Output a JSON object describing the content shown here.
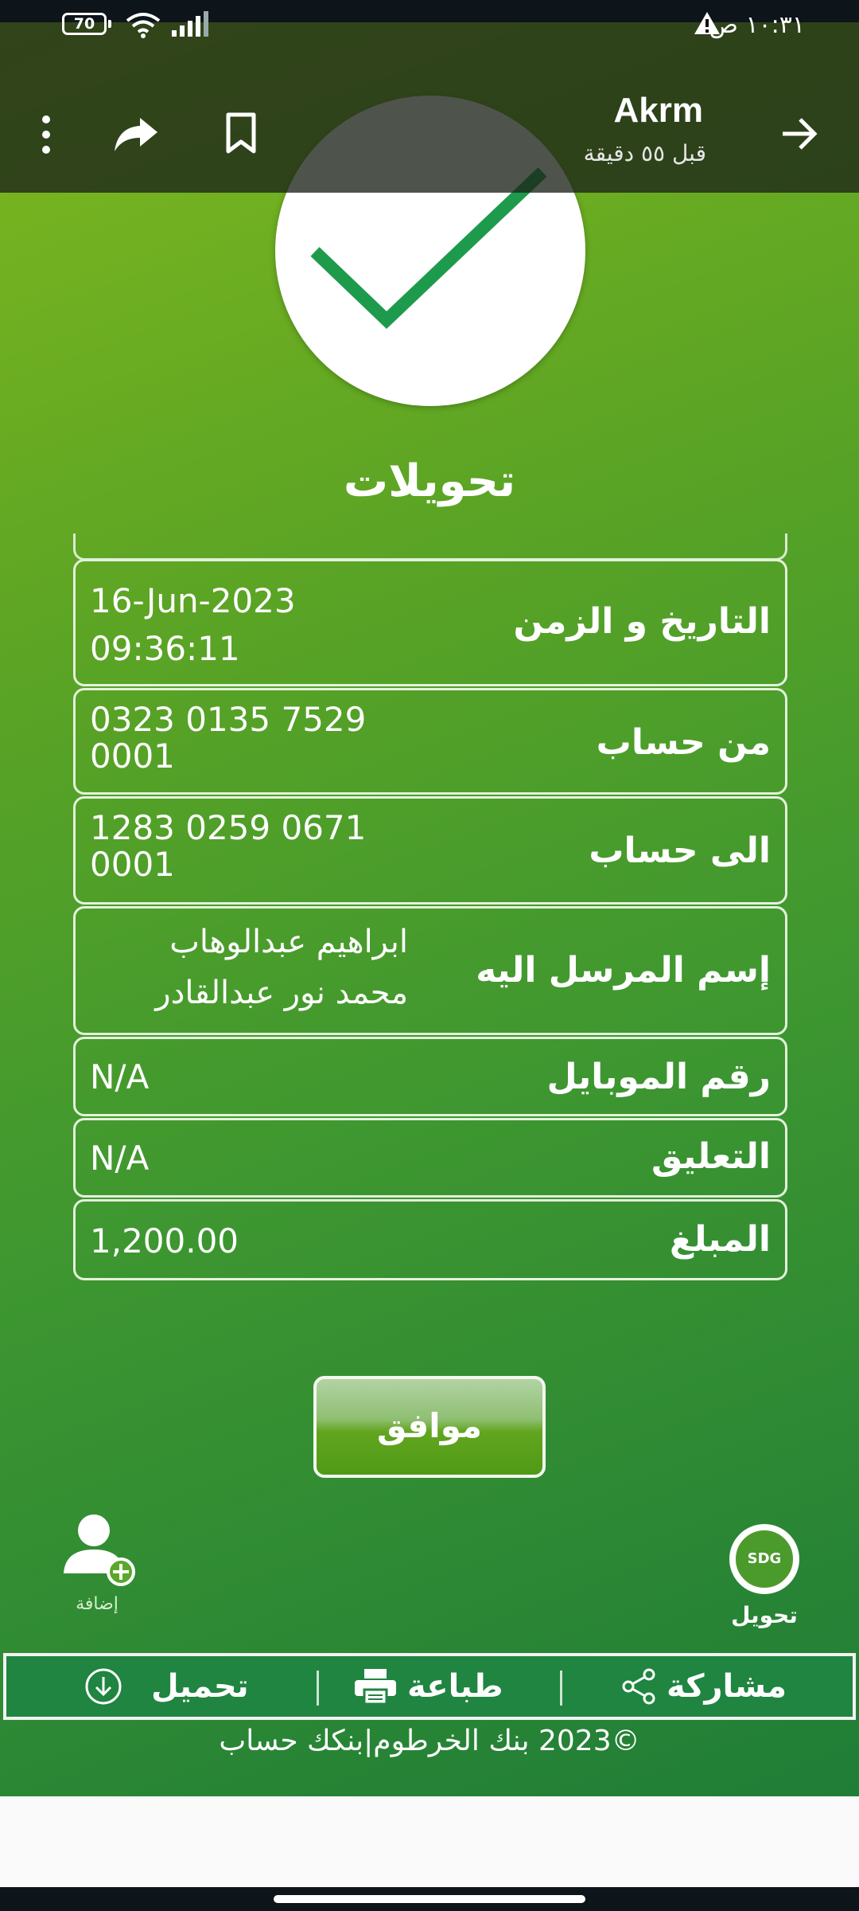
{
  "status_bar": {
    "battery": "70",
    "time": "١٠:٣١ ص"
  },
  "header": {
    "sender": "Akrm",
    "time_ago": "قبل ٥٥ دقيقة"
  },
  "page": {
    "title": "تحويلات"
  },
  "details": [
    {
      "label": "التاريخ و الزمن",
      "value": "16-Jun-2023\n09:36:11"
    },
    {
      "label": "من حساب",
      "value": "0323 0135 7529\n0001"
    },
    {
      "label": "الى حساب",
      "value": "1283 0259 0671\n0001"
    },
    {
      "label": "إسم المرسل اليه",
      "value": "ابراهيم عبدالوهاب\nمحمد نور عبدالقادر"
    },
    {
      "label": "رقم الموبايل",
      "value": "N/A"
    },
    {
      "label": "التعليق",
      "value": "N/A"
    },
    {
      "label": "المبلغ",
      "value": "1,200.00"
    }
  ],
  "ok_button": "موافق",
  "add_label": "إضافة",
  "transfer": {
    "badge": "SDG",
    "label": "تحويل"
  },
  "actions": {
    "share": "مشاركة",
    "print": "طباعة",
    "download": "تحميل"
  },
  "footer": "©2023 بنك الخرطوم|بنكك حساب",
  "colors": {
    "green_top": "#7fb81f",
    "green_bottom": "#1f7d37",
    "check": "#1e9a4c"
  }
}
